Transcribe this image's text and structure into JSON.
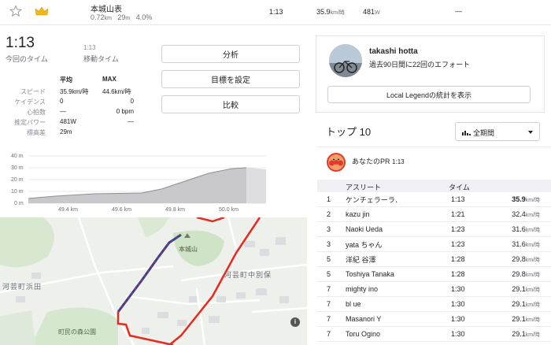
{
  "topbar": {
    "star_icon": "star-icon",
    "crown_icon": "crown-icon",
    "segment_name": "本城山表",
    "distance": "0.72",
    "distance_unit": "km",
    "elevation": "29",
    "elevation_unit": "m",
    "grade": "4.0%",
    "time": "1:13",
    "speed": "35.9",
    "speed_unit": "km/時",
    "power": "481",
    "power_unit": "W",
    "dash": "—"
  },
  "effort": {
    "elapsed_time": "1:13",
    "elapsed_label": "今回のタイム",
    "moving_time": "1:13",
    "moving_label": "移動タイム",
    "col_avg": "平均",
    "col_max": "MAX",
    "rows": [
      {
        "label": "スピード",
        "avg": "35.9km/時",
        "max": "44.6km/時"
      },
      {
        "label": "ケイデンス",
        "avg": "0",
        "max": "0"
      },
      {
        "label": "心拍数",
        "avg": "—",
        "max": "0 bpm"
      },
      {
        "label": "推定パワー",
        "avg": "481W",
        "max": "—"
      },
      {
        "label": "標高差",
        "avg": "29m",
        "max": ""
      }
    ]
  },
  "actions": {
    "analyze": "分析",
    "set_goal": "目標を設定",
    "compare": "比較"
  },
  "elevation_chart": {
    "y_ticks": [
      "40 m",
      "30 m",
      "20 m",
      "10 m",
      "0 m"
    ],
    "x_ticks": [
      "49.4 km",
      "49.6 km",
      "49.8 km",
      "50.0 km"
    ]
  },
  "map": {
    "place1": "本城山",
    "place2": "河芸町中別保",
    "place3": "河芸町浜田",
    "place4": "町民の森公園",
    "info": "i"
  },
  "legend": {
    "user_name": "takashi hotta",
    "efforts": "過去90日間に22回のエフォート",
    "button": "Local Legendの統計を表示"
  },
  "leaderboard": {
    "title": "トップ 10",
    "filter": "全期間",
    "pr_label": "あなたのPR",
    "pr_time": "1:13",
    "header": {
      "athlete": "アスリート",
      "time": "タイム"
    },
    "rows": [
      {
        "rank": "1",
        "name": "ケンチェラーラ．",
        "time": "1:13",
        "speed": "35.9",
        "bold": true
      },
      {
        "rank": "2",
        "name": "kazu jin",
        "time": "1:21",
        "speed": "32.4"
      },
      {
        "rank": "3",
        "name": "Naoki Ueda",
        "time": "1:23",
        "speed": "31.6"
      },
      {
        "rank": "3",
        "name": "yata ちゃん",
        "time": "1:23",
        "speed": "31.6"
      },
      {
        "rank": "5",
        "name": "洋紀 谷澤",
        "time": "1:28",
        "speed": "29.8"
      },
      {
        "rank": "5",
        "name": "Toshiya Tanaka",
        "time": "1:28",
        "speed": "29.8"
      },
      {
        "rank": "7",
        "name": "mighty ino",
        "time": "1:30",
        "speed": "29.1"
      },
      {
        "rank": "7",
        "name": "bl ue",
        "time": "1:30",
        "speed": "29.1"
      },
      {
        "rank": "7",
        "name": "Masanori Y",
        "time": "1:30",
        "speed": "29.1"
      },
      {
        "rank": "7",
        "name": "Toru Ogino",
        "time": "1:30",
        "speed": "29.1"
      }
    ],
    "unit": "km/時"
  }
}
